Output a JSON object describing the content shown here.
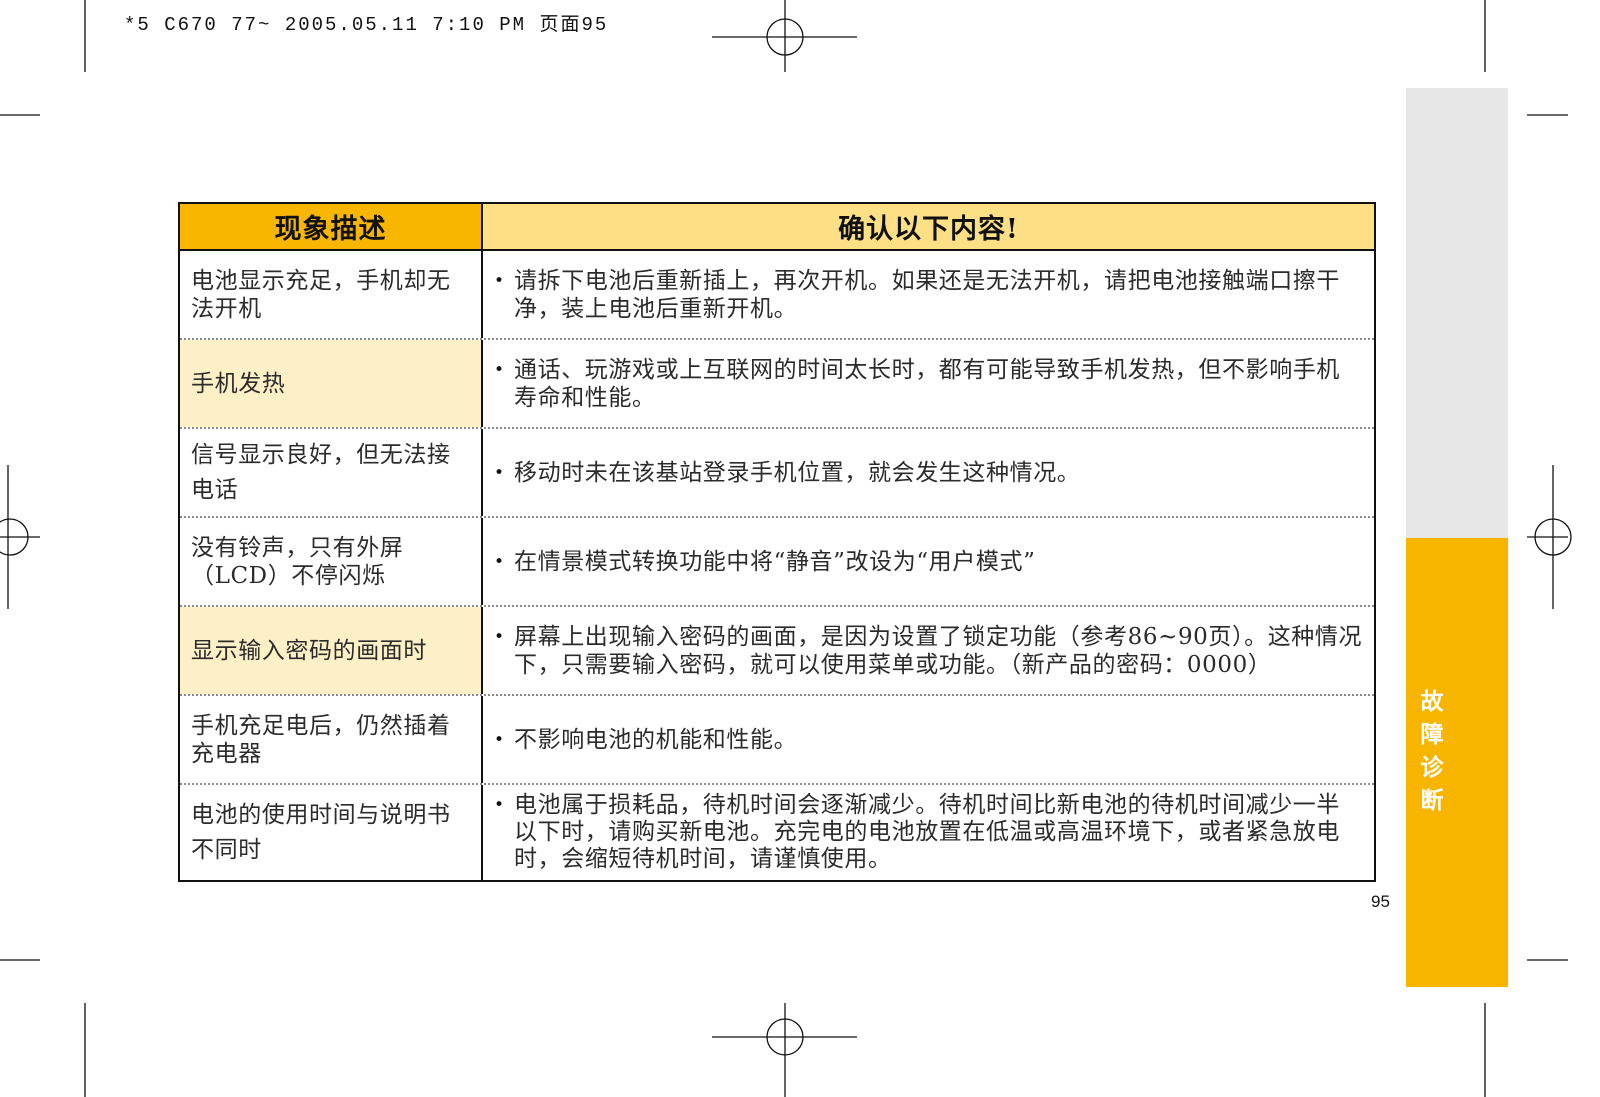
{
  "print_header": "*5 C670 77~ 2005.05.11 7:10 PM 页面95",
  "table": {
    "header_symptom": "现象描述",
    "header_check": "确认以下内容!",
    "bullet": "•",
    "rows": [
      {
        "symptom_lines": [
          "电池显示充足，手机却无",
          "法开机"
        ],
        "check_lines": [
          "请拆下电池后重新插上，再次开机。如果还是无法开机，请把电池接触端口擦干",
          "净，装上电池后重新开机。"
        ],
        "highlighted": false
      },
      {
        "symptom_lines": [
          "手机发热"
        ],
        "check_lines": [
          "通话、玩游戏或上互联网的时间太长时，都有可能导致手机发热，但不影响手机",
          "寿命和性能。"
        ],
        "highlighted": true
      },
      {
        "symptom_lines": [
          "信号显示良好，但无法接",
          "电话"
        ],
        "check_lines": [
          "移动时未在该基站登录手机位置，就会发生这种情况。"
        ],
        "highlighted": false
      },
      {
        "symptom_lines": [
          "没有铃声，只有外屏",
          "（LCD）不停闪烁"
        ],
        "check_lines": [
          "在情景模式转换功能中将“静音”改设为“用户模式”"
        ],
        "highlighted": false
      },
      {
        "symptom_lines": [
          "显示输入密码的画面时"
        ],
        "check_lines": [
          "屏幕上出现输入密码的画面，是因为设置了锁定功能（参考86~90页）。这种情况",
          "下，只需要输入密码，就可以使用菜单或功能。（新产品的密码：0000）"
        ],
        "highlighted": true
      },
      {
        "symptom_lines": [
          "手机充足电后，仍然插着",
          "充电器"
        ],
        "check_lines": [
          "不影响电池的机能和性能。"
        ],
        "highlighted": false
      },
      {
        "symptom_lines": [
          "电池的使用时间与说明书",
          "不同时"
        ],
        "check_lines": [
          "电池属于损耗品，待机时间会逐渐减少。待机时间比新电池的待机时间减少一半",
          "以下时，请购买新电池。充完电的电池放置在低温或高温环境下，或者紧急放电",
          "时，会缩短待机时间，请谨慎使用。"
        ],
        "highlighted": false
      }
    ]
  },
  "side_tab": {
    "label": "故障诊断"
  },
  "page_number": "95",
  "colors": {
    "header_symptom_bg": "#F8B600",
    "header_check_bg": "#FDDF86",
    "highlight_bg": "#FEF0C6",
    "side_tab_gray": "#E6E6E6",
    "side_tab_orange": "#F8B500"
  }
}
